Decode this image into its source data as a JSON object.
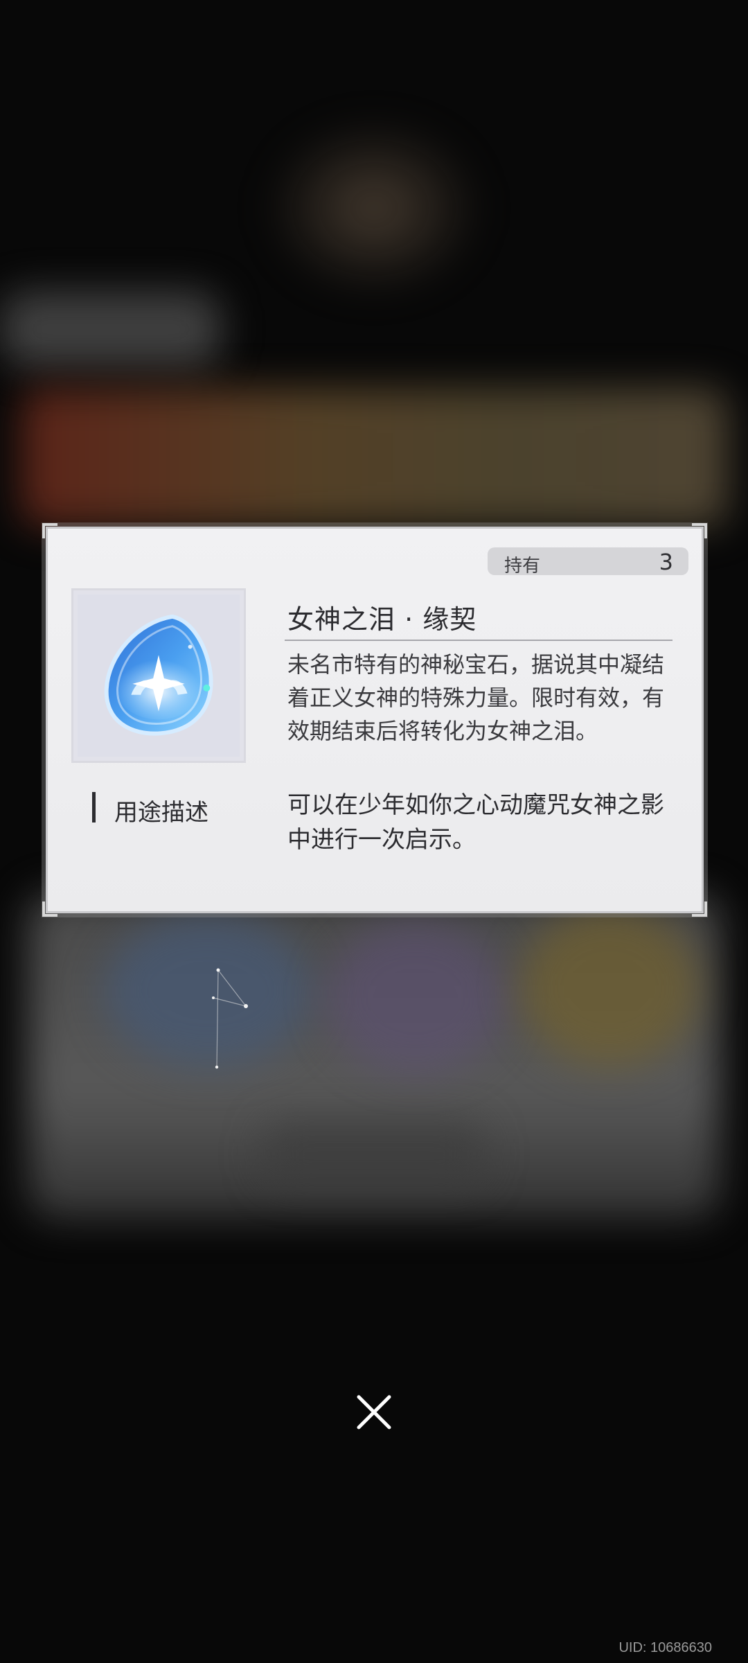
{
  "dialog": {
    "owned_label": "持有",
    "owned_count": "3",
    "item_name": "女神之泪 · 缘契",
    "item_description": "未名市特有的神秘宝石，据说其中凝结着正义女神的特殊力量。限时有效，有效期结束后将转化为女神之泪。",
    "usage_label": "用途描述",
    "usage_text": "可以在少年如你之心动魔咒女神之影中进行一次启示。",
    "item_icon": "blue-tear-gem-icon"
  },
  "close_icon": "close-icon",
  "footer": {
    "uid": "UID: 10686630"
  },
  "colors": {
    "dialog_bg": "#efeff1",
    "gem_blue": "#3d8fe0",
    "text_dark": "#2c2c30"
  }
}
